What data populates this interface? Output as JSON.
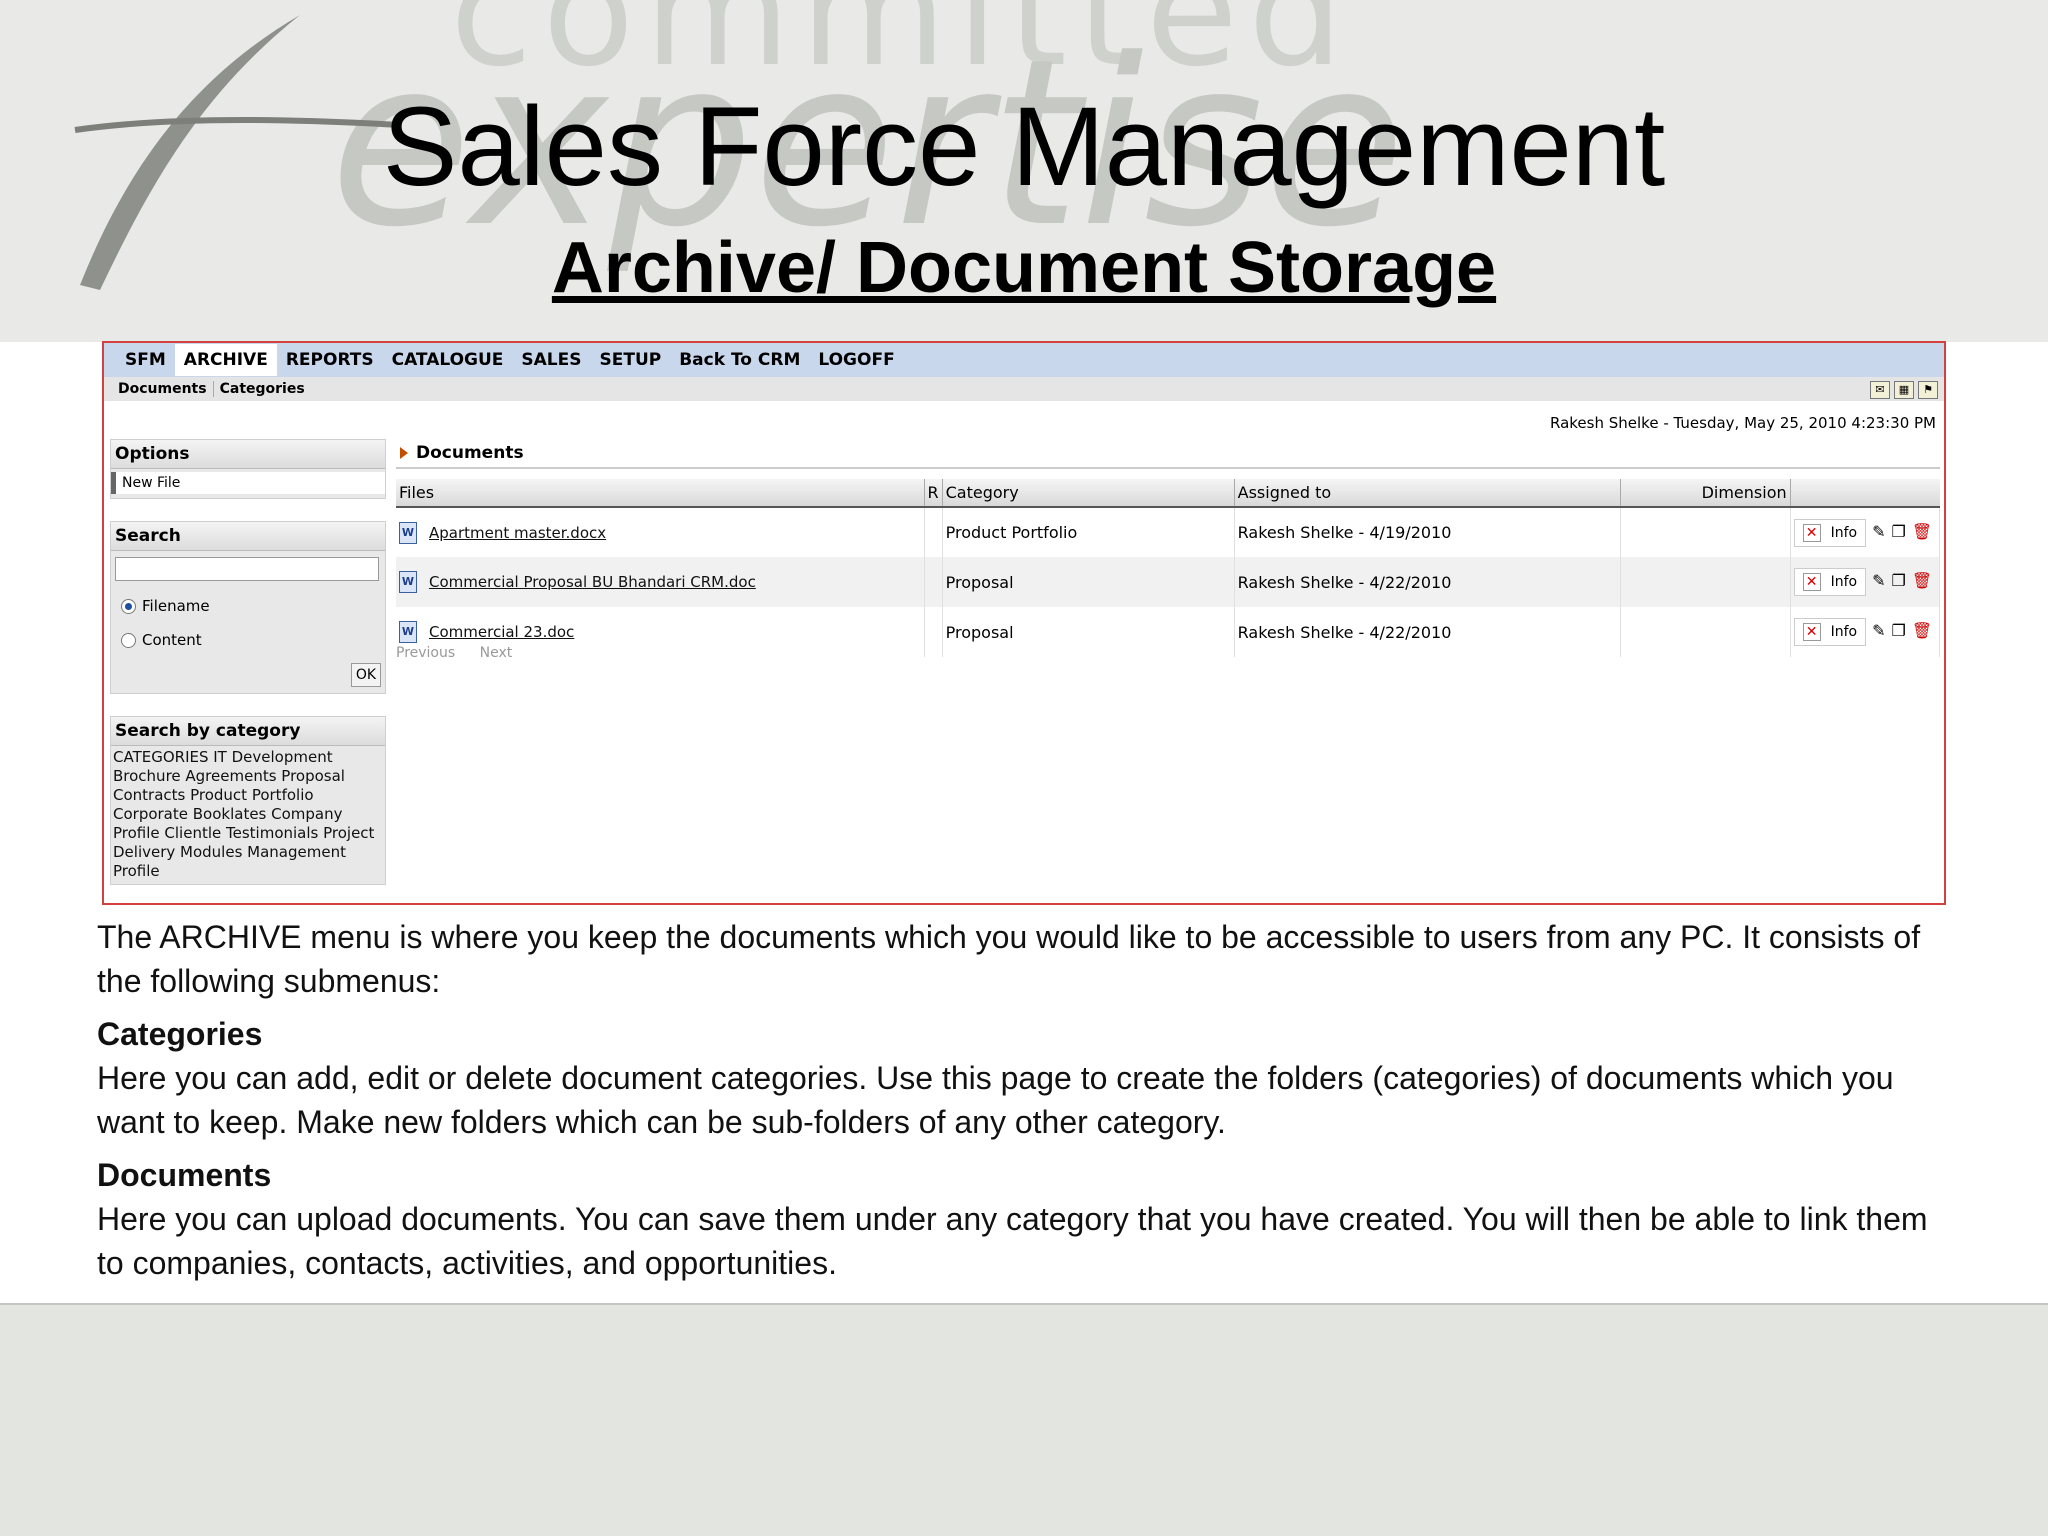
{
  "slide": {
    "title": "Sales Force Management",
    "subtitle": "Archive/ Document Storage",
    "watermark_top": "committed",
    "watermark_bottom": "expertise"
  },
  "menu": [
    "SFM",
    "ARCHIVE",
    "REPORTS",
    "CATALOGUE",
    "SALES",
    "SETUP",
    "Back To CRM",
    "LOGOFF"
  ],
  "submenu": [
    "Documents",
    "Categories"
  ],
  "user_line": "Rakesh Shelke - Tuesday, May 25, 2010 4:23:30 PM",
  "options": {
    "header": "Options",
    "new_file": "New File"
  },
  "search": {
    "header": "Search",
    "value": "",
    "filename": "Filename",
    "content": "Content",
    "ok": "OK"
  },
  "category_search": {
    "header": "Search by category",
    "text": "CATEGORIES IT Development Brochure Agreements Proposal Contracts Product Portfolio Corporate Booklates Company Profile Clientle Testimonials Project Delivery Modules Management Profile"
  },
  "documents": {
    "header": "Documents",
    "columns": [
      "Files",
      "R",
      "Category",
      "Assigned to",
      "Dimension"
    ],
    "rows": [
      {
        "file": "Apartment master.docx",
        "category": "Product Portfolio",
        "assigned": "Rakesh Shelke  - 4/19/2010"
      },
      {
        "file": "Commercial Proposal BU Bhandari CRM.doc",
        "category": "Proposal",
        "assigned": "Rakesh Shelke  - 4/22/2010"
      },
      {
        "file": "Commercial 23.doc",
        "category": "Proposal",
        "assigned": "Rakesh Shelke  - 4/22/2010"
      }
    ],
    "info": "Info",
    "previous": "Previous",
    "next": "Next"
  },
  "description": {
    "intro": "The ARCHIVE menu is where you keep the documents which you would like to be accessible to users from any PC. It consists of the following submenus:",
    "categories_title": "Categories",
    "categories_text": "Here you can add, edit or delete document categories. Use this page to create the folders (categories) of documents which you want to keep. Make new folders which can be sub-folders of any other category.",
    "documents_title": "Documents",
    "documents_text": "Here you can upload documents. You can save them under any category that you have created. You will then be able to link them to companies, contacts, activities, and opportunities."
  }
}
